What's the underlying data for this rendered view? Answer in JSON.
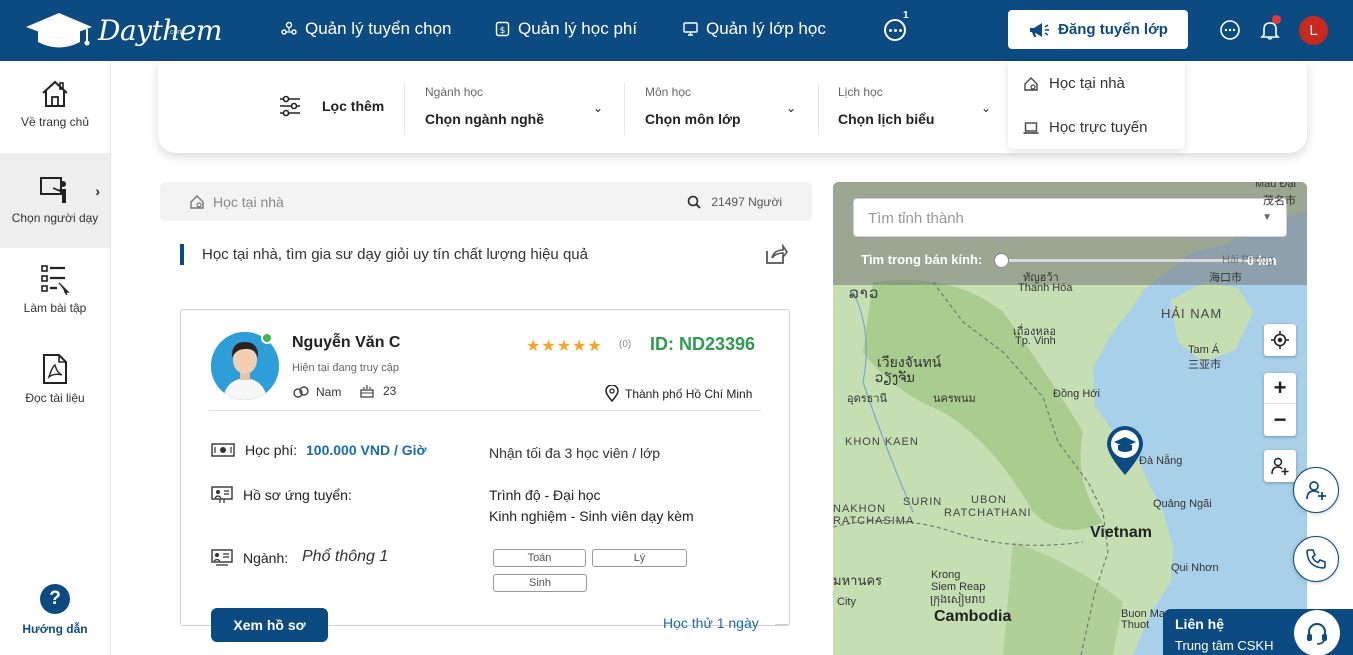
{
  "brand": {
    "name": "Daythem",
    "sub": ".com"
  },
  "nav": {
    "items": [
      {
        "label": "Quản lý tuyển chọn"
      },
      {
        "label": "Quản lý học phí"
      },
      {
        "label": "Quản lý lớp học"
      }
    ],
    "more_badge": "1",
    "post_button": "Đăng tuyển lớp",
    "avatar_initial": "L"
  },
  "dropdown": {
    "items": [
      {
        "label": "Học tại nhà"
      },
      {
        "label": "Học trực tuyến"
      }
    ]
  },
  "sidebar": {
    "items": [
      {
        "label": "Về trang chủ"
      },
      {
        "label": "Chọn người dạy"
      },
      {
        "label": "Làm bài tập"
      },
      {
        "label": "Đọc tài liệu"
      }
    ],
    "help": "Hướng dẫn"
  },
  "filter": {
    "more": "Lọc thêm",
    "groups": [
      {
        "label": "Ngành học",
        "value": "Chọn ngành nghề"
      },
      {
        "label": "Môn học",
        "value": "Chọn môn lớp"
      },
      {
        "label": "Lịch học",
        "value": "Chọn lịch biểu"
      }
    ]
  },
  "search": {
    "placeholder": "Học tại nhà",
    "count": "21497 Người"
  },
  "headline": "Học tại nhà, tìm gia sư dạy giỏi uy tín chất lượng hiệu quả",
  "tutor": {
    "name": "Nguyễn Văn C",
    "status": "Hiện tại đang truy cập",
    "gender": "Nam",
    "age": "23",
    "stars": "★★★★★",
    "rating_count": "(0)",
    "id": "ID: ND23396",
    "location": "Thành phố Hồ Chí Minh",
    "fee_label": "Học phí:",
    "fee": "100.000 VND / Giờ",
    "max_students": "Nhận tối đa 3 học viên / lớp",
    "profile_label": "Hồ sơ ứng tuyển:",
    "level": "Trình độ - Đại học",
    "experience": "Kinh nghiệm - Sinh viên dạy kèm",
    "major_label": "Ngành:",
    "major": "Phổ thông 1",
    "subjects": [
      "Toán",
      "Lý",
      "Sinh"
    ],
    "view_button": "Xem hồ sơ",
    "trial": "Học thử 1 ngày"
  },
  "map": {
    "province_placeholder": "Tìm tỉnh thành",
    "radius_label": "Tìm trong bán kính:",
    "radius_value": "0 km",
    "radius_fraction": 0,
    "labels": [
      "Mẫu Đại",
      "茂名市",
      "Hải Phòng",
      "海口市",
      "ລາວ",
      "Thanh Hóa",
      "ทัญฮว้า",
      "HẢI NAM",
      "Tam Á",
      "三亚市",
      "เวียงจันทน์",
      "ວຽງຈັນ",
      "เถื่องหลอ",
      "Tp. Vinh",
      "อุดรธานี",
      "นครพนม",
      "Đồng Hới",
      "KHON KAEN",
      "Đà Nẵng",
      "SURIN",
      "UBON",
      "RATCHATHANI",
      "Quảng Ngãi",
      "NAKHON",
      "RATCHASIMA",
      "Vietnam",
      "Qui Nhơn",
      "Krong",
      "Siem Reap",
      "ក្រុងសៀមរាប",
      "Cambodia",
      "Buon Ma",
      "Thuot",
      "มหานคร",
      "City"
    ]
  },
  "contact": {
    "title": "Liên hệ",
    "subtitle": "Trung tâm CSKH"
  },
  "colors": {
    "primary": "#0c4b82",
    "link": "#1a6bb0",
    "id_green": "#2e9c4f",
    "star": "#f5a623",
    "water": "#a9d0e9",
    "land": "#c5dfb3"
  }
}
